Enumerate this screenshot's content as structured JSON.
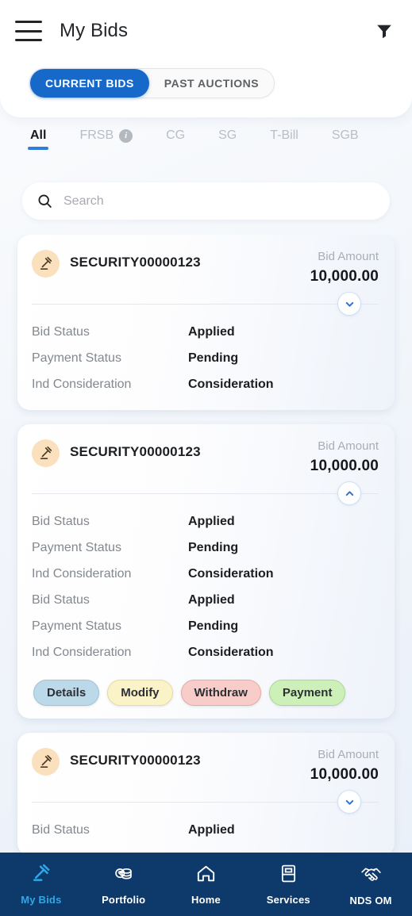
{
  "header": {
    "menu_icon": "hamburger-menu-icon",
    "title": "My Bids",
    "filter_icon": "filter-funnel-icon"
  },
  "segmented": {
    "options": [
      {
        "label": "CURRENT BIDS",
        "active": true
      },
      {
        "label": "PAST AUCTIONS",
        "active": false
      }
    ]
  },
  "tabs": [
    {
      "label": "All",
      "active": true,
      "info": false
    },
    {
      "label": "FRSB",
      "active": false,
      "info": true
    },
    {
      "label": "CG",
      "active": false,
      "info": false
    },
    {
      "label": "SG",
      "active": false,
      "info": false
    },
    {
      "label": "T-Bill",
      "active": false,
      "info": false
    },
    {
      "label": "SGB",
      "active": false,
      "info": false
    }
  ],
  "search": {
    "placeholder": "Search",
    "value": "",
    "icon": "search-icon"
  },
  "cards": [
    {
      "security": "SECURITY00000123",
      "icon": "gavel-icon",
      "bid_amount_label": "Bid Amount",
      "bid_amount_value": "10,000.00",
      "expanded": false,
      "chevron": "chevron-down-icon",
      "details": [
        {
          "label": "Bid Status",
          "value": "Applied"
        },
        {
          "label": "Payment Status",
          "value": "Pending"
        },
        {
          "label": "Ind Consideration",
          "value": "Consideration"
        }
      ],
      "actions": []
    },
    {
      "security": "SECURITY00000123",
      "icon": "gavel-icon",
      "bid_amount_label": "Bid Amount",
      "bid_amount_value": "10,000.00",
      "expanded": true,
      "chevron": "chevron-up-icon",
      "details": [
        {
          "label": "Bid Status",
          "value": "Applied"
        },
        {
          "label": "Payment Status",
          "value": "Pending"
        },
        {
          "label": "Ind Consideration",
          "value": "Consideration"
        },
        {
          "label": "Bid Status",
          "value": "Applied"
        },
        {
          "label": "Payment Status",
          "value": "Pending"
        },
        {
          "label": "Ind Consideration",
          "value": "Consideration"
        }
      ],
      "actions": [
        {
          "label": "Details",
          "bg": "#bcd9ea",
          "border": "#9cc3da"
        },
        {
          "label": "Modify",
          "bg": "#fbf3c8",
          "border": "#e6dba3"
        },
        {
          "label": "Withdraw",
          "bg": "#f8ccc9",
          "border": "#e5aaa6"
        },
        {
          "label": "Payment",
          "bg": "#cdf0b9",
          "border": "#abd794"
        }
      ]
    },
    {
      "security": "SECURITY00000123",
      "icon": "gavel-icon",
      "bid_amount_label": "Bid Amount",
      "bid_amount_value": "10,000.00",
      "expanded": false,
      "chevron": "chevron-down-icon",
      "details": [
        {
          "label": "Bid Status",
          "value": "Applied"
        }
      ],
      "actions": []
    }
  ],
  "bottom_nav": {
    "items": [
      {
        "label": "My Bids",
        "icon": "gavel-icon",
        "active": true
      },
      {
        "label": "Portfolio",
        "icon": "coins-rupee-icon",
        "active": false
      },
      {
        "label": "Home",
        "icon": "home-icon",
        "active": false
      },
      {
        "label": "Services",
        "icon": "ledger-book-icon",
        "active": false
      },
      {
        "label": "NDS OM",
        "icon": "handshake-icon",
        "active": false
      }
    ]
  },
  "colors": {
    "accent_blue": "#1668c9",
    "tab_underline": "#2f7ddb",
    "nav_bar": "#0d3a6b",
    "nav_active": "#2fa8e5",
    "sec_icon_bg": "#fae0bd"
  }
}
